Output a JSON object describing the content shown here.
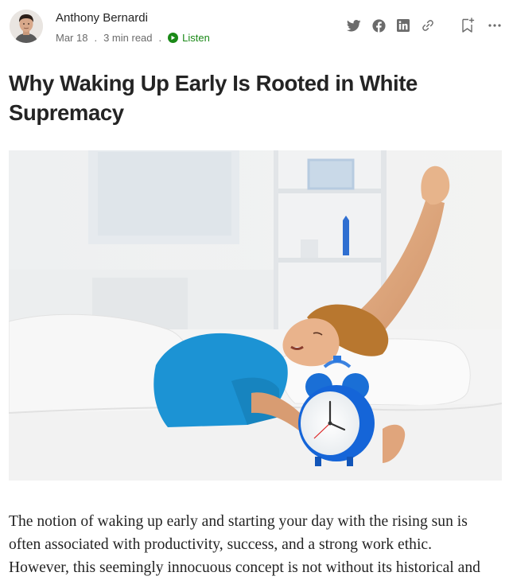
{
  "author": {
    "name": "Anthony Bernardi",
    "date": "Mar 18",
    "read_time": "3 min read",
    "meta_separator": ".",
    "listen_label": "Listen"
  },
  "actions": {
    "icons": [
      "twitter-icon",
      "facebook-icon",
      "linkedin-icon",
      "link-icon",
      "bookmark-add-icon",
      "more-icon"
    ]
  },
  "article": {
    "title": "Why Waking Up Early Is Rooted in White Supremacy",
    "paragraph_lines": [
      "The notion of waking up early and starting your day with the rising sun is",
      "often associated with productivity, success, and a strong work ethic.",
      "However, this seemingly innocuous concept is not without its historical and"
    ]
  },
  "colors": {
    "accent_green": "#1a8917",
    "text": "#242424",
    "muted": "#6b6b6b"
  }
}
